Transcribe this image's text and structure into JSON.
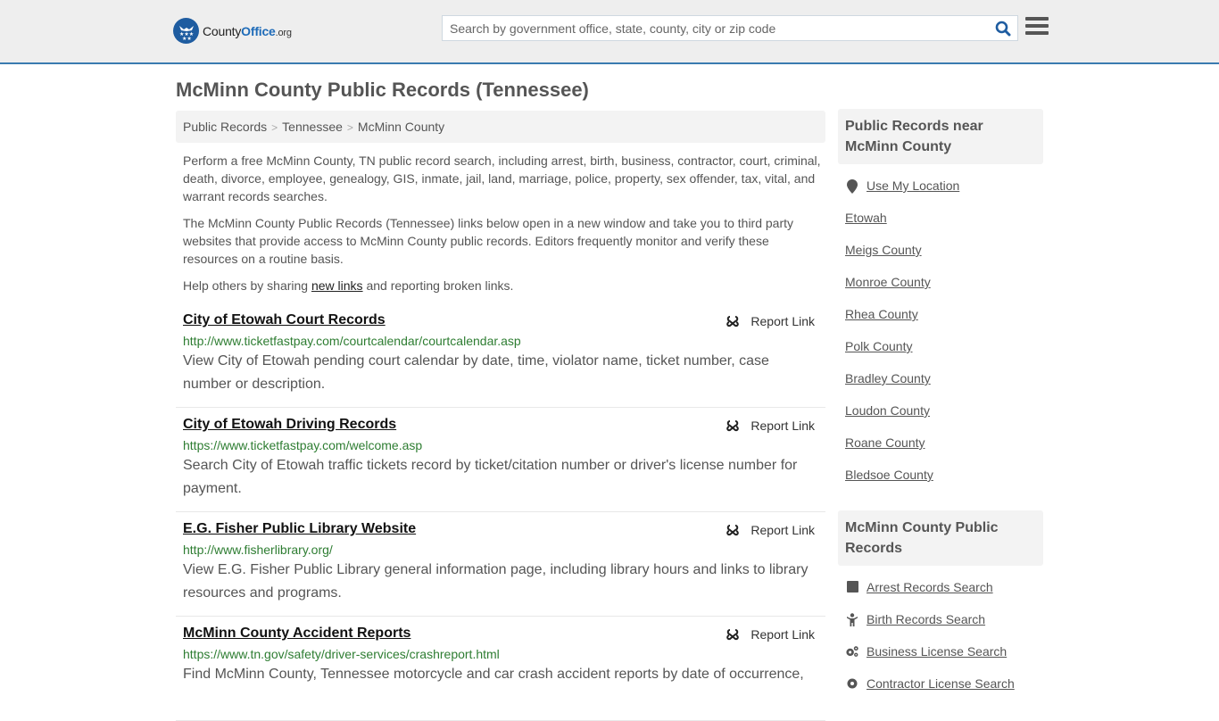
{
  "header": {
    "logo": {
      "name": "County",
      "brand": "Office",
      "tld": ".org"
    },
    "search": {
      "placeholder": "Search by government office, state, county, city or zip code",
      "value": ""
    },
    "search_icon": "search-icon",
    "menu_icon": "hamburger-menu-icon"
  },
  "page": {
    "title": "McMinn County Public Records (Tennessee)"
  },
  "breadcrumb": [
    {
      "label": "Public Records"
    },
    {
      "label": "Tennessee"
    },
    {
      "label": "McMinn County"
    }
  ],
  "breadcrumb_separator": ">",
  "intro": {
    "p1": "Perform a free McMinn County, TN public record search, including arrest, birth, business, contractor, court, criminal, death, divorce, employee, genealogy, GIS, inmate, jail, land, marriage, police, property, sex offender, tax, vital, and warrant records searches.",
    "p2": "The McMinn County Public Records (Tennessee) links below open in a new window and take you to third party websites that provide access to McMinn County public records. Editors frequently monitor and verify these resources on a routine basis.",
    "p3_before": "Help others by sharing ",
    "p3_link": "new links",
    "p3_after": " and reporting broken links."
  },
  "records": [
    {
      "title": "City of Etowah Court Records",
      "url": "http://www.ticketfastpay.com/courtcalendar/courtcalendar.asp",
      "description": "View City of Etowah pending court calendar by date, time, violator name, ticket number, case number or description.",
      "report_label": "Report Link"
    },
    {
      "title": "City of Etowah Driving Records",
      "url": "https://www.ticketfastpay.com/welcome.asp",
      "description": "Search City of Etowah traffic tickets record by ticket/citation number or driver's license number for payment.",
      "report_label": "Report Link"
    },
    {
      "title": "E.G. Fisher Public Library Website",
      "url": "http://www.fisherlibrary.org/",
      "description": "View E.G. Fisher Public Library general information page, including library hours and links to library resources and programs.",
      "report_label": "Report Link"
    },
    {
      "title": "McMinn County Accident Reports",
      "url": "https://www.tn.gov/safety/driver-services/crashreport.html",
      "description": "Find McMinn County, Tennessee motorcycle and car crash accident reports by date of occurrence,",
      "report_label": "Report Link"
    }
  ],
  "sidebar": {
    "near": {
      "heading": "Public Records near McMinn County",
      "use_location": "Use My Location",
      "items": [
        "Etowah",
        "Meigs County",
        "Monroe County",
        "Rhea County",
        "Polk County",
        "Bradley County",
        "Loudon County",
        "Roane County",
        "Bledsoe County"
      ]
    },
    "county_records": {
      "heading": "McMinn County Public Records",
      "items": [
        {
          "label": "Arrest Records Search",
          "icon": "square-icon"
        },
        {
          "label": "Birth Records Search",
          "icon": "child-icon"
        },
        {
          "label": "Business License Search",
          "icon": "cogs-icon"
        },
        {
          "label": "Contractor License Search",
          "icon": "gear-icon"
        }
      ]
    }
  },
  "colors": {
    "brand_blue": "#1e5ca0",
    "header_border": "#3a7bb0",
    "url_green": "#2e7d32",
    "text_gray": "#555555"
  }
}
